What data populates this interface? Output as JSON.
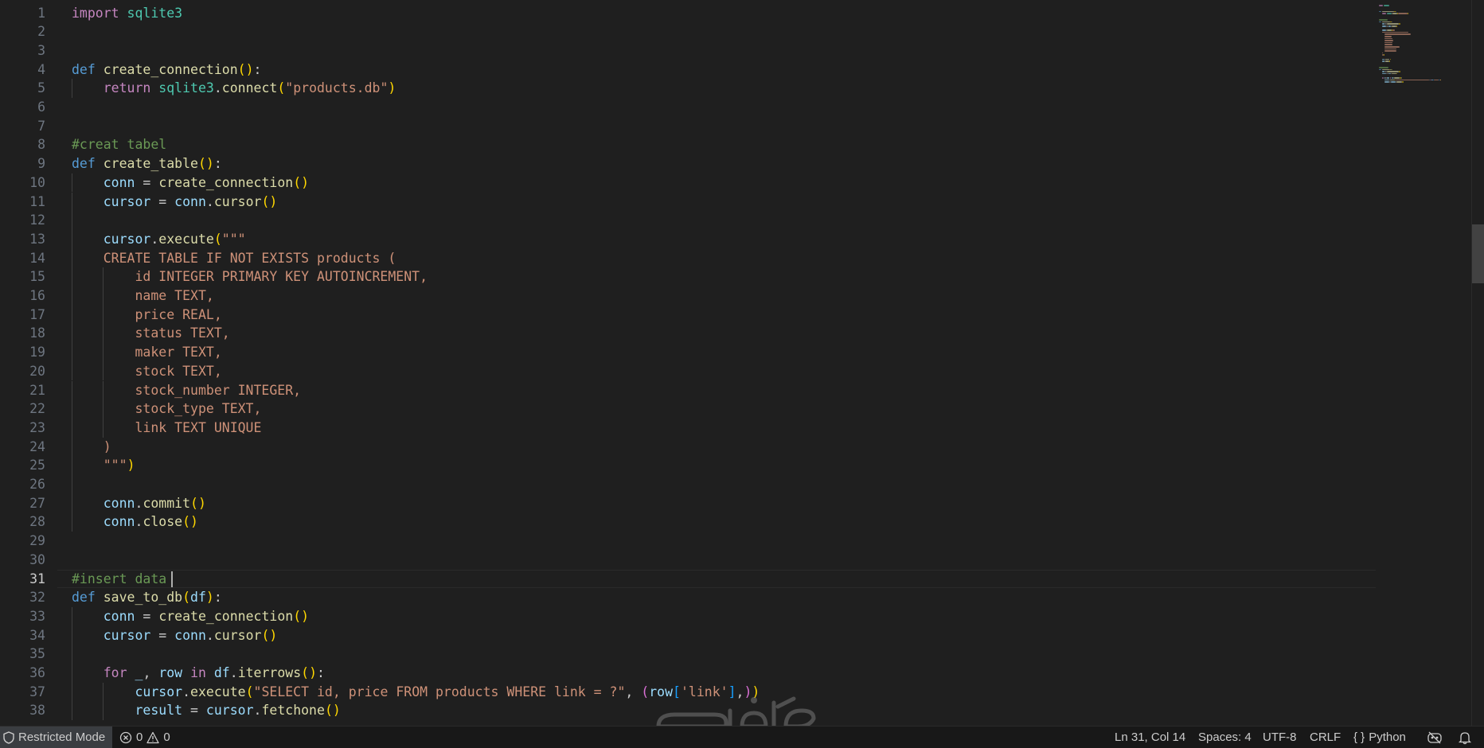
{
  "editor": {
    "cursor": {
      "line": 31,
      "col": 14
    },
    "lines": [
      {
        "n": "1",
        "tokens": [
          [
            "kw",
            "import"
          ],
          [
            "pl",
            " "
          ],
          [
            "mod",
            "sqlite3"
          ]
        ]
      },
      {
        "n": "2",
        "tokens": []
      },
      {
        "n": "3",
        "tokens": []
      },
      {
        "n": "4",
        "tokens": [
          [
            "def",
            "def"
          ],
          [
            "pl",
            " "
          ],
          [
            "fn",
            "create_connection"
          ],
          [
            "b1",
            "()"
          ],
          [
            "pl",
            ":"
          ]
        ]
      },
      {
        "n": "5",
        "indent": 1,
        "tokens": [
          [
            "pl",
            "    "
          ],
          [
            "kw",
            "return"
          ],
          [
            "pl",
            " "
          ],
          [
            "mod",
            "sqlite3"
          ],
          [
            "pl",
            "."
          ],
          [
            "fn",
            "connect"
          ],
          [
            "b1",
            "("
          ],
          [
            "str",
            "\"products.db\""
          ],
          [
            "b1",
            ")"
          ]
        ]
      },
      {
        "n": "6",
        "tokens": []
      },
      {
        "n": "7",
        "tokens": []
      },
      {
        "n": "8",
        "tokens": [
          [
            "cm",
            "#creat tabel"
          ]
        ]
      },
      {
        "n": "9",
        "tokens": [
          [
            "def",
            "def"
          ],
          [
            "pl",
            " "
          ],
          [
            "fn",
            "create_table"
          ],
          [
            "b1",
            "()"
          ],
          [
            "pl",
            ":"
          ]
        ]
      },
      {
        "n": "10",
        "indent": 1,
        "tokens": [
          [
            "pl",
            "    "
          ],
          [
            "var",
            "conn"
          ],
          [
            "pl",
            " = "
          ],
          [
            "fn",
            "create_connection"
          ],
          [
            "b1",
            "()"
          ]
        ]
      },
      {
        "n": "11",
        "indent": 1,
        "tokens": [
          [
            "pl",
            "    "
          ],
          [
            "var",
            "cursor"
          ],
          [
            "pl",
            " = "
          ],
          [
            "var",
            "conn"
          ],
          [
            "pl",
            "."
          ],
          [
            "fn",
            "cursor"
          ],
          [
            "b1",
            "()"
          ]
        ]
      },
      {
        "n": "12",
        "indent": 1,
        "tokens": []
      },
      {
        "n": "13",
        "indent": 1,
        "tokens": [
          [
            "pl",
            "    "
          ],
          [
            "var",
            "cursor"
          ],
          [
            "pl",
            "."
          ],
          [
            "fn",
            "execute"
          ],
          [
            "b1",
            "("
          ],
          [
            "str",
            "\"\"\""
          ]
        ]
      },
      {
        "n": "14",
        "indent": 1,
        "tokens": [
          [
            "pl",
            "    "
          ],
          [
            "str",
            "CREATE TABLE IF NOT EXISTS products ("
          ]
        ]
      },
      {
        "n": "15",
        "indent": 2,
        "tokens": [
          [
            "pl",
            "        "
          ],
          [
            "str",
            "id INTEGER PRIMARY KEY AUTOINCREMENT,"
          ]
        ]
      },
      {
        "n": "16",
        "indent": 2,
        "tokens": [
          [
            "pl",
            "        "
          ],
          [
            "str",
            "name TEXT,"
          ]
        ]
      },
      {
        "n": "17",
        "indent": 2,
        "tokens": [
          [
            "pl",
            "        "
          ],
          [
            "str",
            "price REAL,"
          ]
        ]
      },
      {
        "n": "18",
        "indent": 2,
        "tokens": [
          [
            "pl",
            "        "
          ],
          [
            "str",
            "status TEXT,"
          ]
        ]
      },
      {
        "n": "19",
        "indent": 2,
        "tokens": [
          [
            "pl",
            "        "
          ],
          [
            "str",
            "maker TEXT,"
          ]
        ]
      },
      {
        "n": "20",
        "indent": 2,
        "tokens": [
          [
            "pl",
            "        "
          ],
          [
            "str",
            "stock TEXT,"
          ]
        ]
      },
      {
        "n": "21",
        "indent": 2,
        "tokens": [
          [
            "pl",
            "        "
          ],
          [
            "str",
            "stock_number INTEGER,"
          ]
        ]
      },
      {
        "n": "22",
        "indent": 2,
        "tokens": [
          [
            "pl",
            "        "
          ],
          [
            "str",
            "stock_type TEXT,"
          ]
        ]
      },
      {
        "n": "23",
        "indent": 2,
        "tokens": [
          [
            "pl",
            "        "
          ],
          [
            "str",
            "link TEXT UNIQUE"
          ]
        ]
      },
      {
        "n": "24",
        "indent": 1,
        "tokens": [
          [
            "pl",
            "    "
          ],
          [
            "str",
            ")"
          ]
        ]
      },
      {
        "n": "25",
        "indent": 1,
        "tokens": [
          [
            "pl",
            "    "
          ],
          [
            "str",
            "\"\"\""
          ],
          [
            "b1",
            ")"
          ]
        ]
      },
      {
        "n": "26",
        "indent": 1,
        "tokens": []
      },
      {
        "n": "27",
        "indent": 1,
        "tokens": [
          [
            "pl",
            "    "
          ],
          [
            "var",
            "conn"
          ],
          [
            "pl",
            "."
          ],
          [
            "fn",
            "commit"
          ],
          [
            "b1",
            "()"
          ]
        ]
      },
      {
        "n": "28",
        "indent": 1,
        "tokens": [
          [
            "pl",
            "    "
          ],
          [
            "var",
            "conn"
          ],
          [
            "pl",
            "."
          ],
          [
            "fn",
            "close"
          ],
          [
            "b1",
            "()"
          ]
        ]
      },
      {
        "n": "29",
        "tokens": []
      },
      {
        "n": "30",
        "tokens": []
      },
      {
        "n": "31",
        "active": true,
        "tokens": [
          [
            "cm",
            "#insert data "
          ]
        ]
      },
      {
        "n": "32",
        "tokens": [
          [
            "def",
            "def"
          ],
          [
            "pl",
            " "
          ],
          [
            "fn",
            "save_to_db"
          ],
          [
            "b1",
            "("
          ],
          [
            "var",
            "df"
          ],
          [
            "b1",
            ")"
          ],
          [
            "pl",
            ":"
          ]
        ]
      },
      {
        "n": "33",
        "indent": 1,
        "tokens": [
          [
            "pl",
            "    "
          ],
          [
            "var",
            "conn"
          ],
          [
            "pl",
            " = "
          ],
          [
            "fn",
            "create_connection"
          ],
          [
            "b1",
            "()"
          ]
        ]
      },
      {
        "n": "34",
        "indent": 1,
        "tokens": [
          [
            "pl",
            "    "
          ],
          [
            "var",
            "cursor"
          ],
          [
            "pl",
            " = "
          ],
          [
            "var",
            "conn"
          ],
          [
            "pl",
            "."
          ],
          [
            "fn",
            "cursor"
          ],
          [
            "b1",
            "()"
          ]
        ]
      },
      {
        "n": "35",
        "indent": 1,
        "tokens": []
      },
      {
        "n": "36",
        "indent": 1,
        "tokens": [
          [
            "pl",
            "    "
          ],
          [
            "kw",
            "for"
          ],
          [
            "pl",
            " "
          ],
          [
            "var",
            "_"
          ],
          [
            "pl",
            ", "
          ],
          [
            "var",
            "row"
          ],
          [
            "pl",
            " "
          ],
          [
            "kw",
            "in"
          ],
          [
            "pl",
            " "
          ],
          [
            "var",
            "df"
          ],
          [
            "pl",
            "."
          ],
          [
            "fn",
            "iterrows"
          ],
          [
            "b1",
            "()"
          ],
          [
            "pl",
            ":"
          ]
        ]
      },
      {
        "n": "37",
        "indent": 2,
        "tokens": [
          [
            "pl",
            "        "
          ],
          [
            "var",
            "cursor"
          ],
          [
            "pl",
            "."
          ],
          [
            "fn",
            "execute"
          ],
          [
            "b1",
            "("
          ],
          [
            "str",
            "\"SELECT id, price FROM products WHERE link = ?\""
          ],
          [
            "pl",
            ", "
          ],
          [
            "b2",
            "("
          ],
          [
            "var",
            "row"
          ],
          [
            "b3",
            "["
          ],
          [
            "str",
            "'link'"
          ],
          [
            "b3",
            "]"
          ],
          [
            "pl",
            ","
          ],
          [
            "b2",
            ")"
          ],
          [
            "b1",
            ")"
          ]
        ]
      },
      {
        "n": "38",
        "indent": 2,
        "tokens": [
          [
            "pl",
            "        "
          ],
          [
            "var",
            "result"
          ],
          [
            "pl",
            " = "
          ],
          [
            "var",
            "cursor"
          ],
          [
            "pl",
            "."
          ],
          [
            "fn",
            "fetchone"
          ],
          [
            "b1",
            "()"
          ]
        ]
      }
    ]
  },
  "statusbar": {
    "restricted_mode": "Restricted Mode",
    "errors": "0",
    "warnings": "0",
    "position": "Ln 31, Col 14",
    "spaces": "Spaces: 4",
    "encoding": "UTF-8",
    "eol": "CRLF",
    "language": "Python",
    "language_icon": "{ }"
  },
  "watermark": {
    "text": "خمسات"
  },
  "colors": {
    "background": "#1f1f1f",
    "keyword": "#c586c0",
    "function": "#dcdcaa",
    "string": "#ce9178",
    "comment": "#6a9955",
    "variable": "#9cdcfe",
    "module": "#4ec9b0"
  }
}
